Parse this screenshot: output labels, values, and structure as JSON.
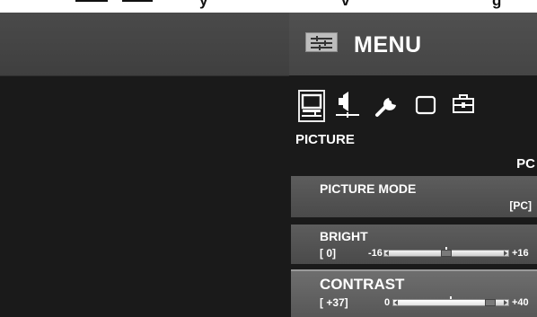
{
  "top_strip": {
    "fragments": [
      "",
      "",
      "y",
      "v",
      "",
      "g"
    ]
  },
  "menu": {
    "title": "MENU",
    "icons": [
      "picture-icon",
      "audio-icon",
      "setup-icon",
      "screen-icon",
      "toolbox-icon"
    ],
    "selected_icon": "picture-icon",
    "category": "PICTURE",
    "source": "PC",
    "items": [
      {
        "label": "PICTURE MODE",
        "value": "[PC]"
      },
      {
        "label": "BRIGHT",
        "value_text": "[    0]",
        "min": "-16",
        "max": "+16",
        "level": 0,
        "range": [
          -16,
          16
        ]
      },
      {
        "label": "CONTRAST",
        "value_text": "[ +37]",
        "min": "0",
        "max": "+40",
        "level": 37,
        "range": [
          0,
          40
        ]
      }
    ]
  },
  "colors": {
    "panel": "#1a1a1a",
    "header": "#4a4a4a",
    "item": "#555555",
    "text": "#ffffff"
  }
}
